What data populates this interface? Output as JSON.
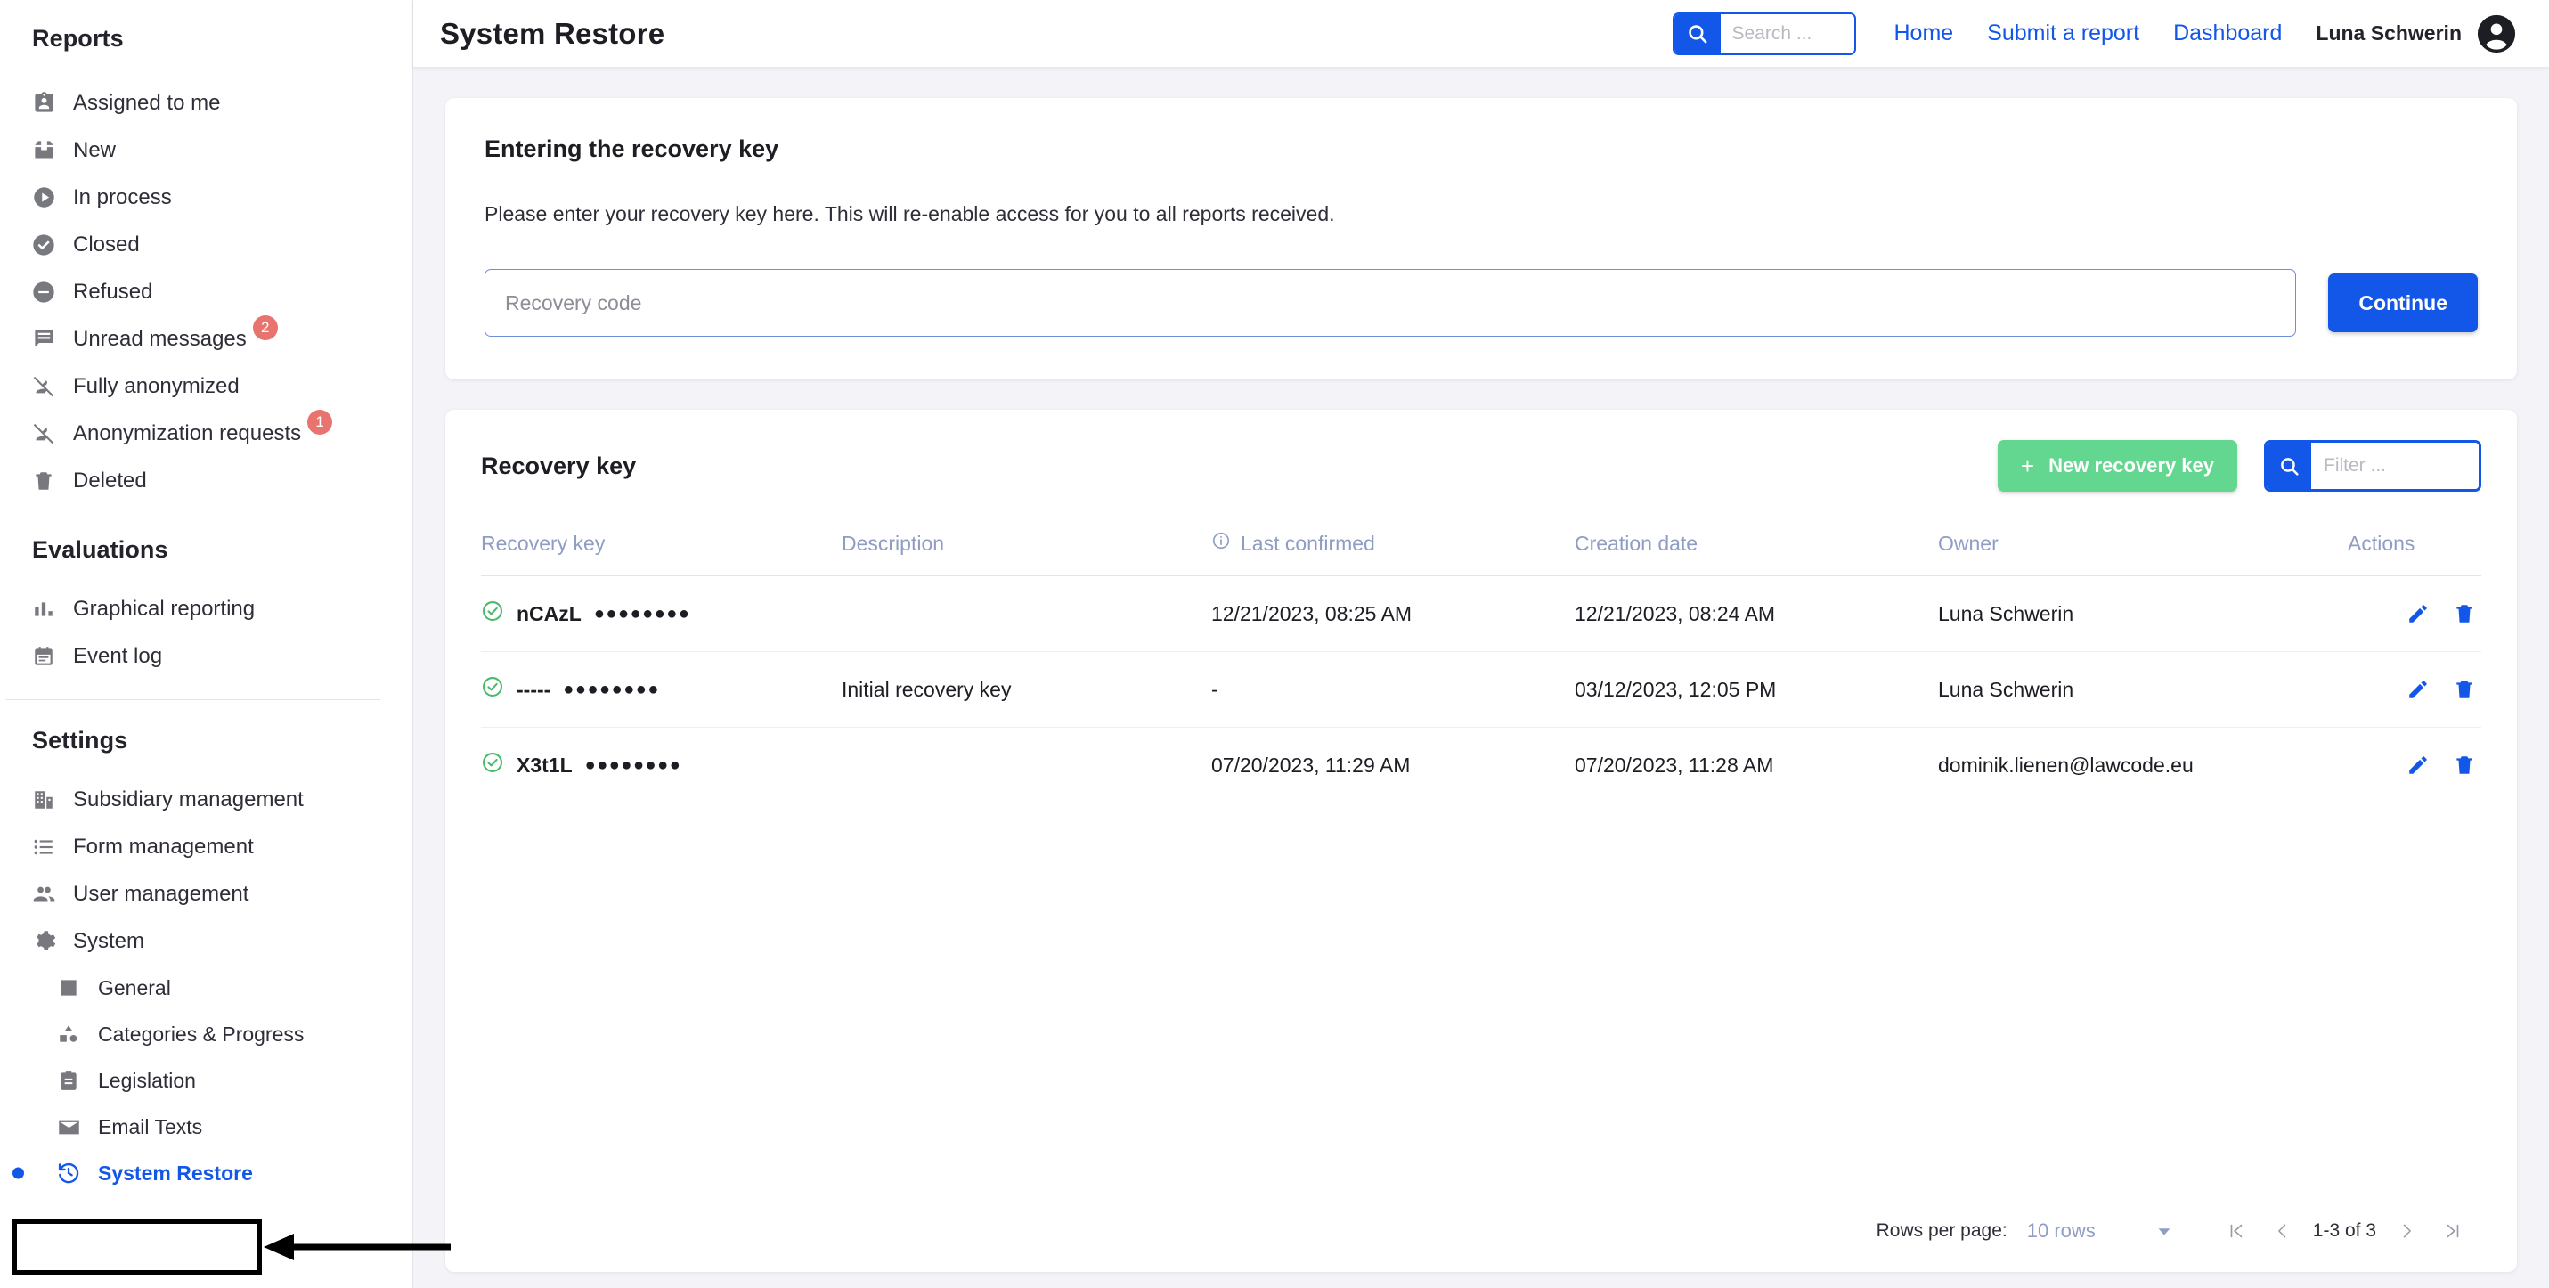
{
  "sidebar": {
    "sections": [
      {
        "title": "Reports",
        "items": [
          {
            "label": "Assigned to me",
            "icon": "badge-person-icon",
            "badge": null
          },
          {
            "label": "New",
            "icon": "inbox-icon",
            "badge": null
          },
          {
            "label": "In process",
            "icon": "play-circle-icon",
            "badge": null
          },
          {
            "label": "Closed",
            "icon": "check-circle-icon",
            "badge": null
          },
          {
            "label": "Refused",
            "icon": "minus-circle-icon",
            "badge": null
          },
          {
            "label": "Unread messages",
            "icon": "chat-icon",
            "badge": "2"
          },
          {
            "label": "Fully anonymized",
            "icon": "person-off-icon",
            "badge": null
          },
          {
            "label": "Anonymization requests",
            "icon": "person-off-icon",
            "badge": "1"
          },
          {
            "label": "Deleted",
            "icon": "trash-icon",
            "badge": null
          }
        ]
      },
      {
        "title": "Evaluations",
        "items": [
          {
            "label": "Graphical reporting",
            "icon": "bar-chart-icon",
            "badge": null
          },
          {
            "label": "Event log",
            "icon": "calendar-icon",
            "badge": null
          }
        ]
      },
      {
        "title": "Settings",
        "items": [
          {
            "label": "Subsidiary management",
            "icon": "building-icon",
            "badge": null
          },
          {
            "label": "Form management",
            "icon": "list-icon",
            "badge": null
          },
          {
            "label": "User management",
            "icon": "people-icon",
            "badge": null
          },
          {
            "label": "System",
            "icon": "gear-icon",
            "badge": null
          }
        ],
        "sub_items": [
          {
            "label": "General",
            "icon": "gear-square-icon"
          },
          {
            "label": "Categories & Progress",
            "icon": "shapes-icon"
          },
          {
            "label": "Legislation",
            "icon": "clipboard-icon"
          },
          {
            "label": "Email Texts",
            "icon": "envelope-icon"
          },
          {
            "label": "System Restore",
            "icon": "history-restore-icon",
            "active": true
          }
        ]
      }
    ]
  },
  "header": {
    "title": "System Restore",
    "search_placeholder": "Search ...",
    "search_value": "",
    "nav_links": [
      "Home",
      "Submit a report",
      "Dashboard"
    ],
    "user_name": "Luna Schwerin"
  },
  "recovery_card": {
    "heading": "Entering the recovery key",
    "description": "Please enter your recovery key here. This will re-enable access for you to all reports received.",
    "input_placeholder": "Recovery code",
    "input_value": "",
    "continue_label": "Continue"
  },
  "table_card": {
    "title": "Recovery key",
    "new_key_label": "New recovery key",
    "new_key_plus": "+",
    "filter_placeholder": "Filter ...",
    "filter_value": "",
    "columns": [
      "Recovery key",
      "Description",
      "Last confirmed",
      "Creation date",
      "Owner",
      "Actions"
    ],
    "rows": [
      {
        "key_prefix": "nCAzL",
        "key_mask": "●●●●●●●●",
        "description": "",
        "last_confirmed": "12/21/2023, 08:25 AM",
        "creation_date": "12/21/2023, 08:24 AM",
        "owner": "Luna Schwerin"
      },
      {
        "key_prefix": "-----",
        "key_mask": "●●●●●●●●",
        "description": "Initial recovery key",
        "last_confirmed": "-",
        "creation_date": "03/12/2023, 12:05 PM",
        "owner": "Luna Schwerin"
      },
      {
        "key_prefix": "X3t1L",
        "key_mask": "●●●●●●●●",
        "description": "",
        "last_confirmed": "07/20/2023, 11:29 AM",
        "creation_date": "07/20/2023, 11:28 AM",
        "owner": "dominik.lienen@lawcode.eu"
      }
    ],
    "pagination": {
      "rows_per_page_label": "Rows per page:",
      "rows_per_page_value": "10 rows",
      "range_label": "1-3 of 3"
    }
  },
  "colors": {
    "accent_blue": "#1257e8",
    "green": "#63d690",
    "badge_red": "#e9736e",
    "header_text": "#8f9dc4",
    "page_bg": "#f4f4f8",
    "status_green": "#49b96a"
  }
}
